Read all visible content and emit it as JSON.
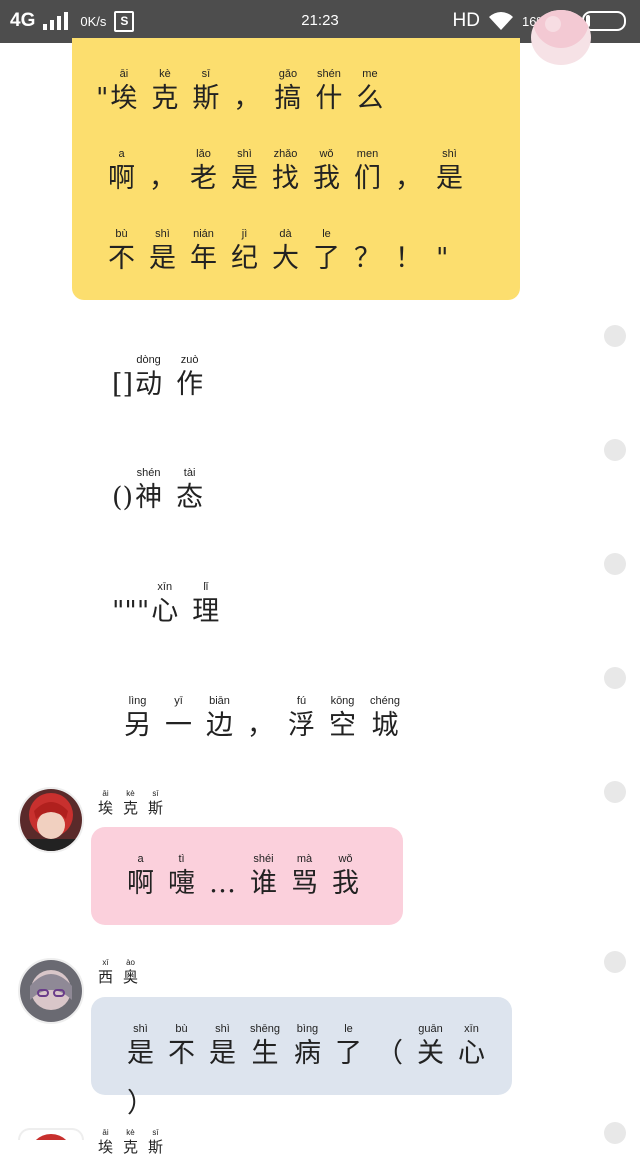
{
  "status_bar": {
    "network": "4G",
    "speed": "0K/s",
    "s_icon": "S",
    "time": "21:23",
    "hd": "HD",
    "battery_pct": "16%",
    "icons": [
      "signal-icon",
      "wifi-icon",
      "charging-icon",
      "battery-icon"
    ]
  },
  "colors": {
    "status_bg": "#4d4d4d",
    "yellow_bubble": "#fcde6e",
    "pink_bubble": "#fbd0dc",
    "blue_bubble": "#dde4ee"
  },
  "messages": {
    "yellow_quote": {
      "lines": [
        {
          "open_quote": "\"",
          "chars": [
            {
              "hz": "埃",
              "py": "āi"
            },
            {
              "hz": "克",
              "py": "kè"
            },
            {
              "hz": "斯",
              "py": "sī"
            },
            {
              "hz": "，",
              "py": ""
            },
            {
              "hz": "搞",
              "py": "gǎo"
            },
            {
              "hz": "什",
              "py": "shén"
            },
            {
              "hz": "么",
              "py": "me"
            }
          ]
        },
        {
          "chars": [
            {
              "hz": "啊",
              "py": "a"
            },
            {
              "hz": "，",
              "py": ""
            },
            {
              "hz": "老",
              "py": "lǎo"
            },
            {
              "hz": "是",
              "py": "shì"
            },
            {
              "hz": "找",
              "py": "zhǎo"
            },
            {
              "hz": "我",
              "py": "wǒ"
            },
            {
              "hz": "们",
              "py": "men"
            },
            {
              "hz": "，",
              "py": ""
            },
            {
              "hz": "是",
              "py": "shì"
            }
          ]
        },
        {
          "chars": [
            {
              "hz": "不",
              "py": "bù"
            },
            {
              "hz": "是",
              "py": "shì"
            },
            {
              "hz": "年",
              "py": "nián"
            },
            {
              "hz": "纪",
              "py": "jì"
            },
            {
              "hz": "大",
              "py": "dà"
            },
            {
              "hz": "了",
              "py": "le"
            },
            {
              "hz": "？",
              "py": ""
            },
            {
              "hz": "！",
              "py": ""
            },
            {
              "hz": "\"",
              "py": ""
            }
          ]
        }
      ]
    },
    "narration": [
      {
        "prefix": "[]",
        "chars": [
          {
            "hz": "动",
            "py": "dòng"
          },
          {
            "hz": "作",
            "py": "zuò"
          }
        ]
      },
      {
        "prefix": "()",
        "chars": [
          {
            "hz": "神",
            "py": "shén"
          },
          {
            "hz": "态",
            "py": "tài"
          }
        ]
      },
      {
        "prefix": "\"\"\"",
        "chars": [
          {
            "hz": "心",
            "py": "xīn"
          },
          {
            "hz": "理",
            "py": "lǐ"
          }
        ]
      },
      {
        "prefix": "",
        "chars": [
          {
            "hz": "另",
            "py": "lìng"
          },
          {
            "hz": "一",
            "py": "yī"
          },
          {
            "hz": "边",
            "py": "biān"
          },
          {
            "hz": "，",
            "py": ""
          },
          {
            "hz": "浮",
            "py": "fú"
          },
          {
            "hz": "空",
            "py": "kōng"
          },
          {
            "hz": "城",
            "py": "chéng"
          }
        ]
      }
    ],
    "ax": {
      "nickname": [
        {
          "hz": "埃",
          "py": "āi"
        },
        {
          "hz": "克",
          "py": "kè"
        },
        {
          "hz": "斯",
          "py": "sī"
        }
      ],
      "text": [
        {
          "hz": "啊",
          "py": "a"
        },
        {
          "hz": "嚏",
          "py": "tì"
        },
        {
          "hz": "…",
          "py": ""
        },
        {
          "hz": "谁",
          "py": "shéi"
        },
        {
          "hz": "骂",
          "py": "mà"
        },
        {
          "hz": "我",
          "py": "wǒ"
        }
      ]
    },
    "xiao": {
      "nickname": [
        {
          "hz": "西",
          "py": "xī"
        },
        {
          "hz": "奥",
          "py": "ào"
        }
      ],
      "text": [
        {
          "hz": "是",
          "py": "shì"
        },
        {
          "hz": "不",
          "py": "bù"
        },
        {
          "hz": "是",
          "py": "shì"
        },
        {
          "hz": "生",
          "py": "shēng"
        },
        {
          "hz": "病",
          "py": "bìng"
        },
        {
          "hz": "了",
          "py": "le"
        },
        {
          "hz": "（",
          "py": ""
        },
        {
          "hz": "关",
          "py": "guān"
        },
        {
          "hz": "心",
          "py": "xīn"
        },
        {
          "hz": "）",
          "py": ""
        }
      ]
    },
    "ax_bottom": {
      "nickname": [
        {
          "hz": "埃",
          "py": "āi"
        },
        {
          "hz": "克",
          "py": "kè"
        },
        {
          "hz": "斯",
          "py": "sī"
        }
      ]
    }
  }
}
